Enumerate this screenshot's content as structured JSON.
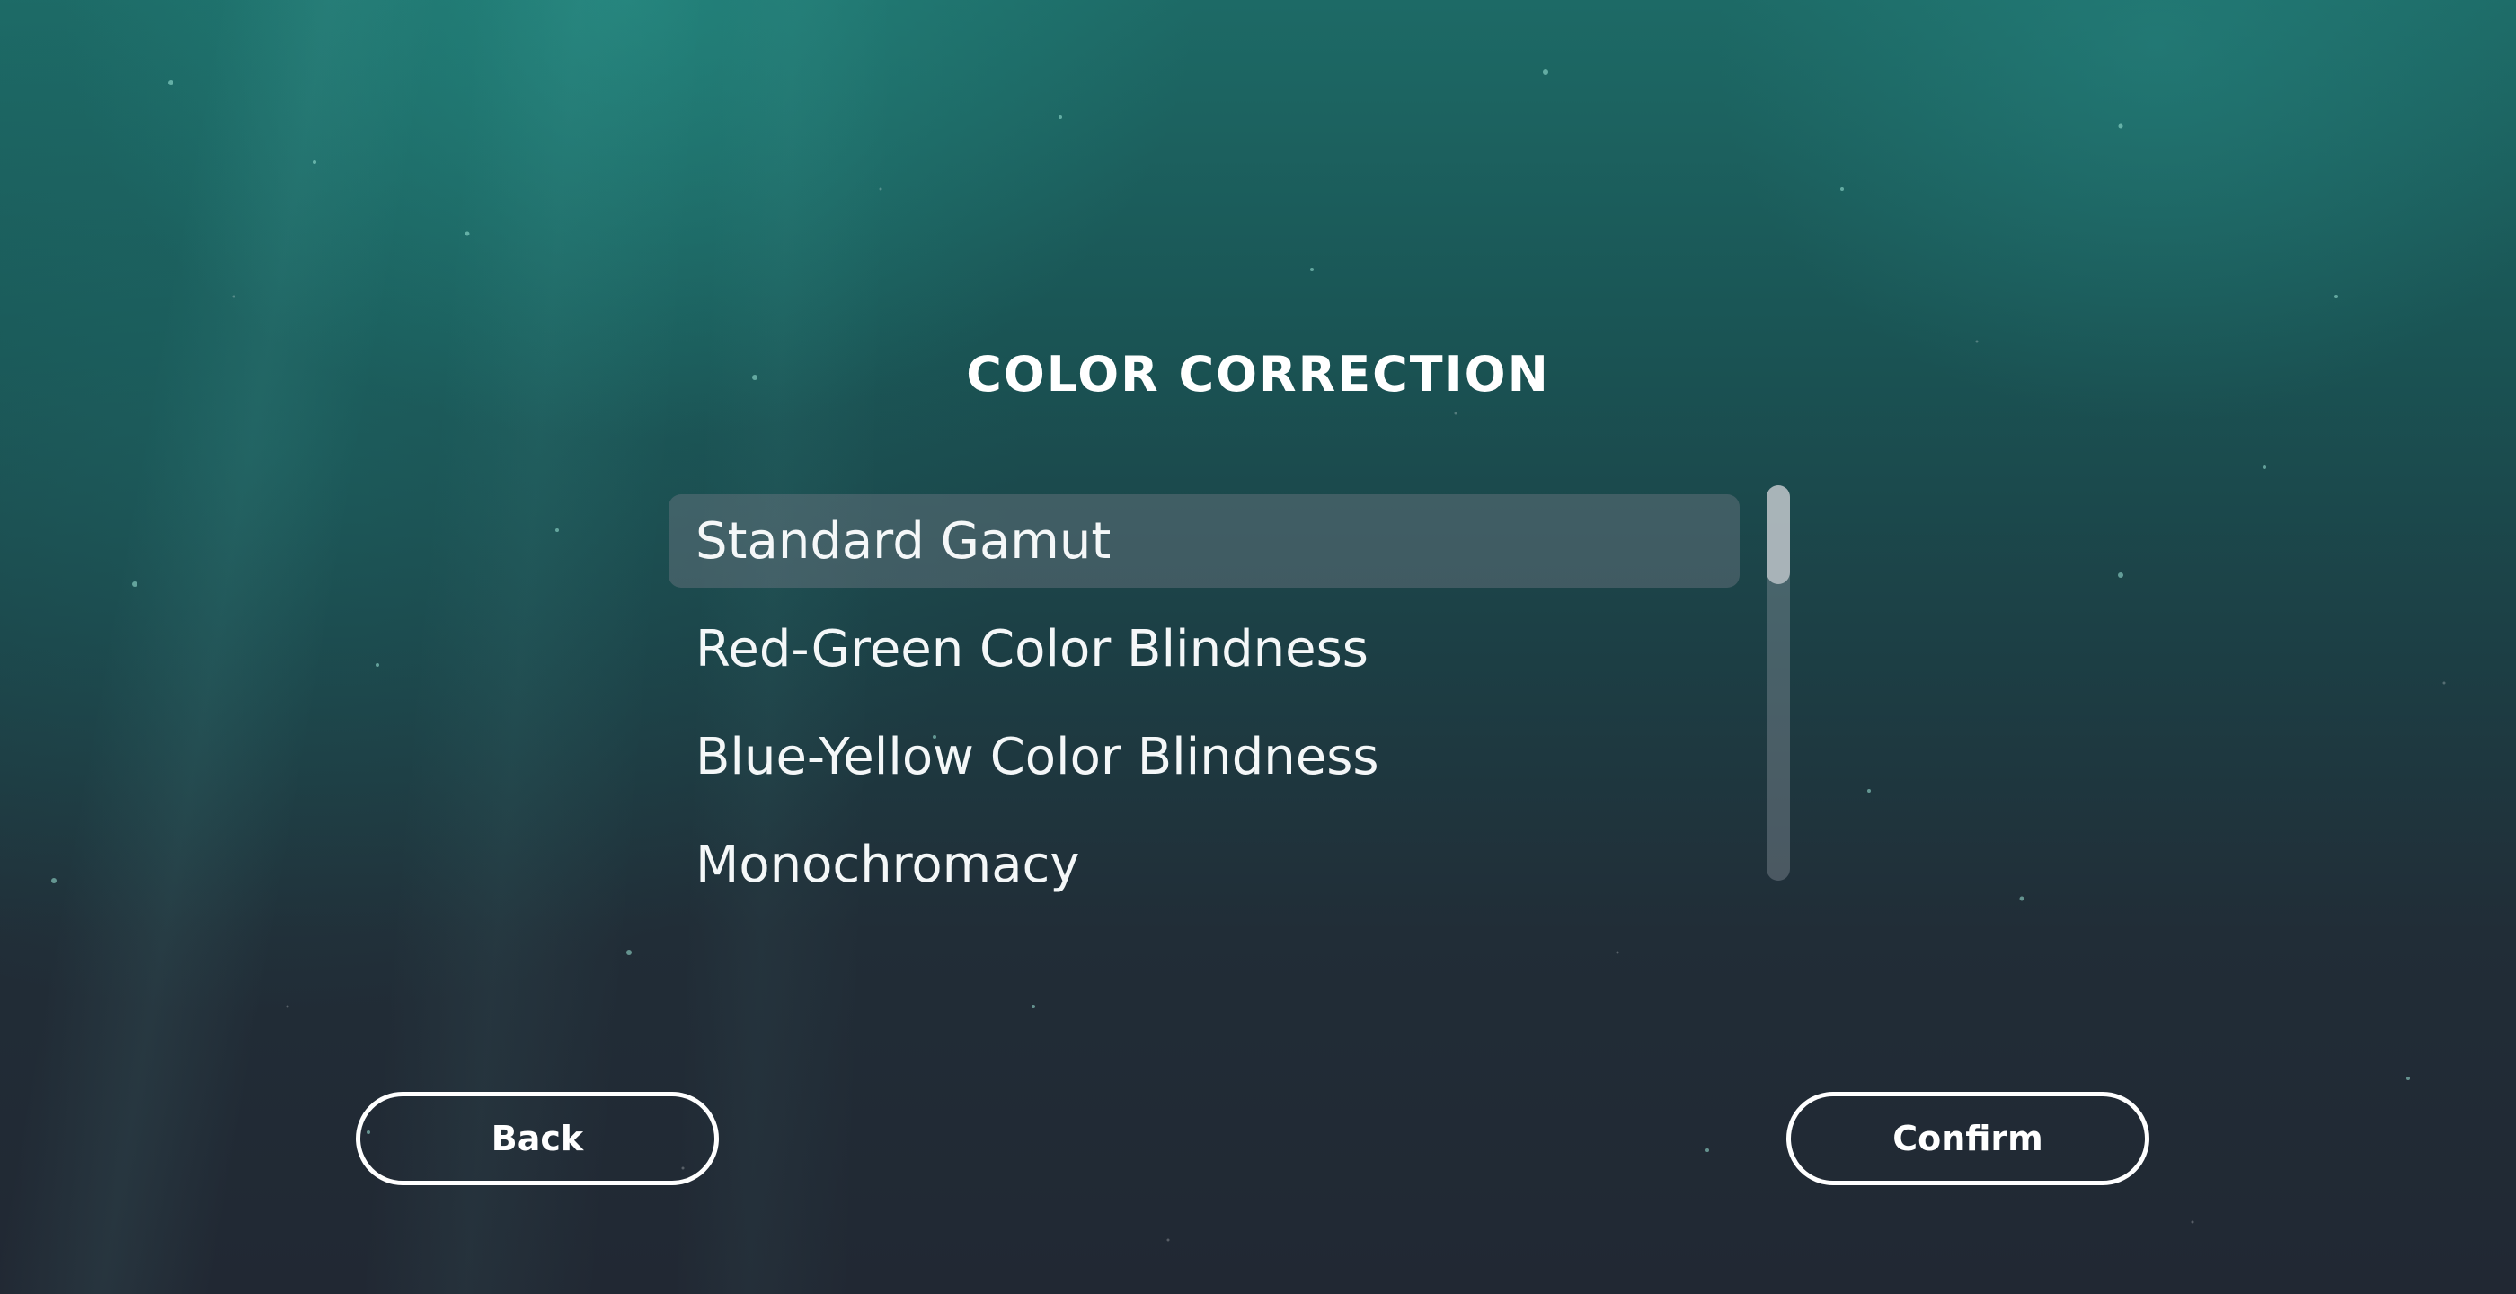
{
  "screen": {
    "title": "COLOR CORRECTION"
  },
  "options": {
    "items": [
      {
        "label": "Standard Gamut",
        "selected": true
      },
      {
        "label": "Red-Green Color Blindness",
        "selected": false
      },
      {
        "label": "Blue-Yellow Color Blindness",
        "selected": false
      },
      {
        "label": "Monochromacy",
        "selected": false
      }
    ],
    "scroll_position": 0
  },
  "buttons": {
    "back_label": "Back",
    "confirm_label": "Confirm"
  },
  "colors": {
    "text": "#ffffff",
    "background_top": "#1d6a66",
    "background_bottom": "#212833",
    "selection_highlight": "#6e7882"
  }
}
